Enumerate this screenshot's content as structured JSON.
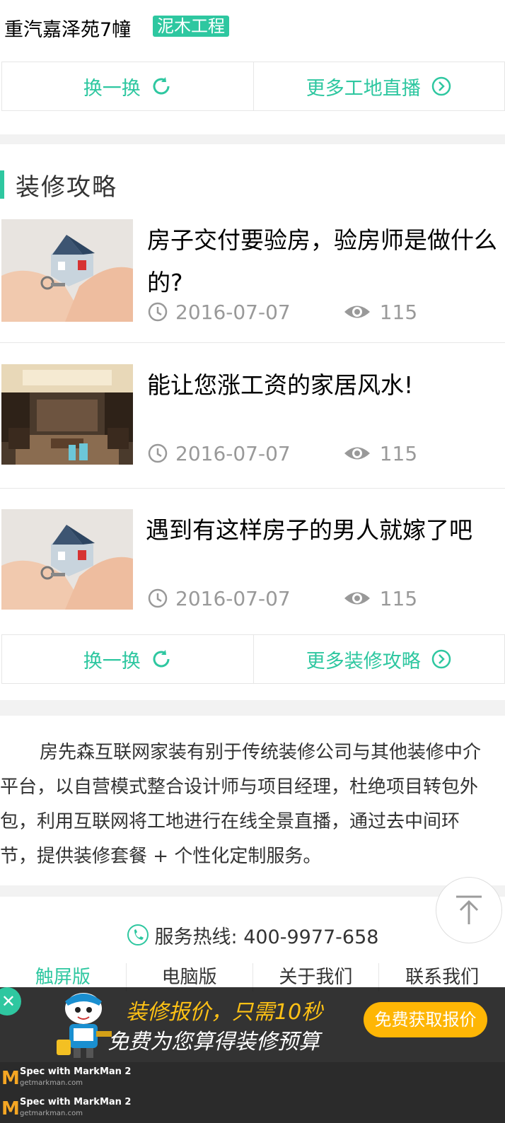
{
  "site": {
    "name": "重汽嘉泽苑7幢",
    "stage": "泥木工程"
  },
  "site_buttons": {
    "swap": "换一换",
    "more": "更多工地直播"
  },
  "guide": {
    "title": "装修攻略",
    "articles": [
      {
        "title": "房子交付要验房，验房师是做什么的?",
        "date": "2016-07-07",
        "views": "115"
      },
      {
        "title": "能让您涨工资的家居风水!",
        "date": "2016-07-07",
        "views": "115"
      },
      {
        "title": "遇到有这样房子的男人就嫁了吧",
        "date": "2016-07-07",
        "views": "115"
      }
    ],
    "swap": "换一换",
    "more": "更多装修攻略"
  },
  "intro": "房先森互联网家装有别于传统装修公司与其他装修中介平台，以自营模式整合设计师与项目经理，杜绝项目转包外包，利用互联网将工地进行在线全景直播，通过去中间环节，提供装修套餐 + 个性化定制服务。",
  "hotline": {
    "label": "服务热线: 400-9977-658"
  },
  "footer": {
    "links": [
      "触屏版",
      "电脑版",
      "关于我们",
      "联系我们"
    ]
  },
  "banner": {
    "line1": "装修报价，只需10秒",
    "line2": "免费为您算得装修预算",
    "cta": "免费获取报价"
  },
  "markman": {
    "title": "Spec with MarkMan 2",
    "site": "getmarkman.com"
  },
  "colors": {
    "accent": "#2ec7a0",
    "cta": "#feb605",
    "banner_text": "#fec115"
  }
}
